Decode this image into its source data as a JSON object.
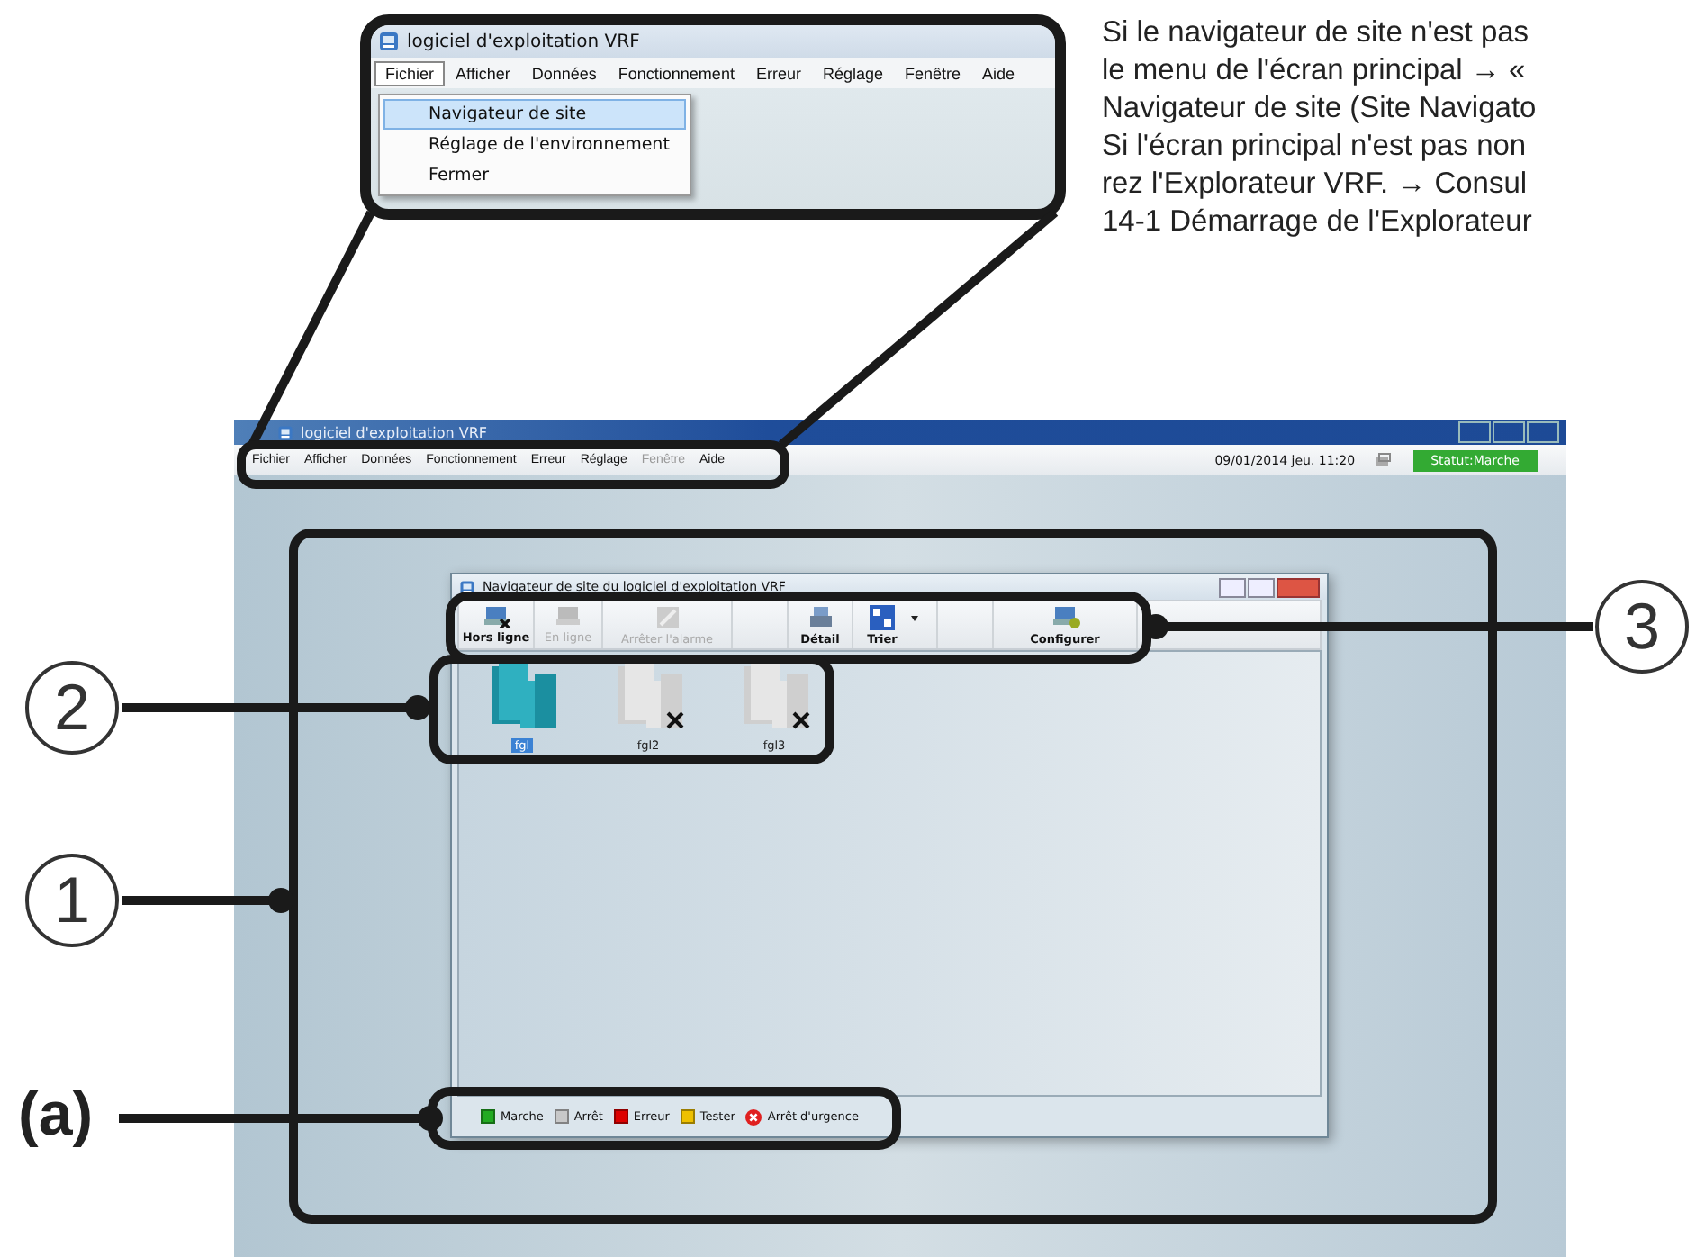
{
  "note": {
    "lines": [
      "Si le navigateur de site n'est pas",
      "le menu de l'écran principal → «",
      "Navigateur de site (Site Navigato",
      "Si l'écran principal n'est pas non",
      "rez l'Explorateur VRF.  → Consul",
      "14-1 Démarrage de l'Explorateur"
    ]
  },
  "inset": {
    "title": "logiciel d'exploitation VRF",
    "menu": [
      {
        "label": "Fichier",
        "open": true
      },
      {
        "label": "Afficher",
        "open": false
      },
      {
        "label": "Données",
        "open": false
      },
      {
        "label": "Fonctionnement",
        "open": false
      },
      {
        "label": "Erreur",
        "open": false
      },
      {
        "label": "Réglage",
        "open": false
      },
      {
        "label": "Fenêtre",
        "open": false
      },
      {
        "label": "Aide",
        "open": false
      }
    ],
    "dropdown": [
      {
        "label": "Navigateur de site",
        "selected": true
      },
      {
        "label": "Réglage de l'environnement",
        "selected": false
      },
      {
        "label": "Fermer",
        "selected": false
      }
    ]
  },
  "main_window": {
    "title": "logiciel d'exploitation VRF",
    "menu": [
      {
        "label": "Fichier",
        "disabled": false
      },
      {
        "label": "Afficher",
        "disabled": false
      },
      {
        "label": "Données",
        "disabled": false
      },
      {
        "label": "Fonctionnement",
        "disabled": false
      },
      {
        "label": "Erreur",
        "disabled": false
      },
      {
        "label": "Réglage",
        "disabled": false
      },
      {
        "label": "Fenêtre",
        "disabled": true
      },
      {
        "label": "Aide",
        "disabled": false
      }
    ],
    "datetime": "09/01/2014 jeu. 11:20",
    "status": "Statut:Marche"
  },
  "site_navigator": {
    "title": "Navigateur de site du logiciel d'exploitation VRF",
    "toolbar": [
      {
        "kind": "button",
        "label": "Hors ligne",
        "disabled": false
      },
      {
        "kind": "button",
        "label": "En ligne",
        "disabled": true
      },
      {
        "kind": "button",
        "label": "Arrêter l'alarme",
        "disabled": true
      },
      {
        "kind": "spacer"
      },
      {
        "kind": "button",
        "label": "Détail",
        "disabled": false
      },
      {
        "kind": "dropdown",
        "label": "Trier",
        "disabled": false
      },
      {
        "kind": "spacer"
      },
      {
        "kind": "button",
        "label": "Configurer",
        "disabled": false
      }
    ],
    "sites": [
      {
        "name": "fgl",
        "online": true,
        "selected": true
      },
      {
        "name": "fgl2",
        "online": false,
        "selected": false
      },
      {
        "name": "fgl3",
        "online": false,
        "selected": false
      }
    ],
    "legend": [
      {
        "kind": "swatch",
        "label": "Marche",
        "color": "#22aa22"
      },
      {
        "kind": "swatch",
        "label": "Arrêt",
        "color": "#c8c8c8"
      },
      {
        "kind": "swatch",
        "label": "Erreur",
        "color": "#dd0000"
      },
      {
        "kind": "swatch",
        "label": "Tester",
        "color": "#eec000"
      },
      {
        "kind": "alert",
        "label": "Arrêt d'urgence",
        "color": "#e02020"
      }
    ]
  },
  "callouts": [
    {
      "label": "3"
    },
    {
      "label": "2"
    },
    {
      "label": "1"
    },
    {
      "label": "(a)"
    }
  ]
}
